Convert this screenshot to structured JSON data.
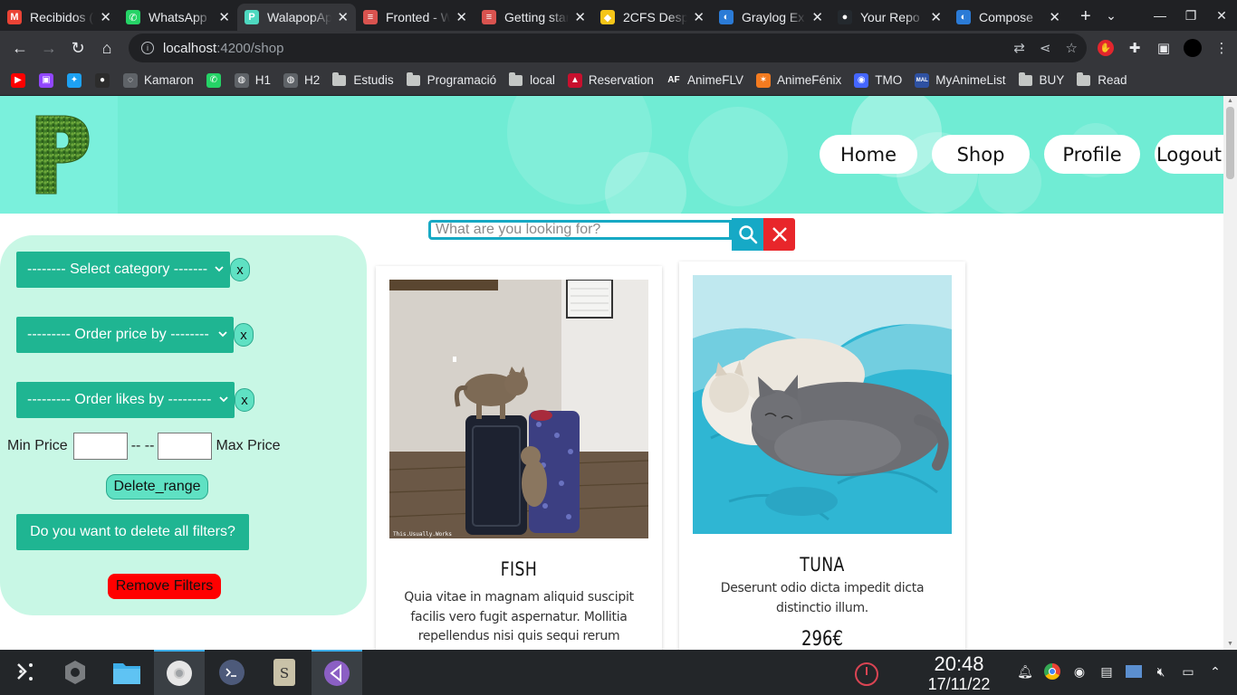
{
  "browser": {
    "tabs": [
      {
        "title": "Recibidos (",
        "icon": "gmail-icon",
        "color": "#ea4335",
        "glyph": "M"
      },
      {
        "title": "WhatsApp",
        "icon": "whatsapp-icon",
        "color": "#25d366",
        "glyph": "✆"
      },
      {
        "title": "WalapopApp",
        "icon": "walapop-icon",
        "color": "#4ed8c0",
        "glyph": "P",
        "active": true
      },
      {
        "title": "Fronted - W",
        "icon": "doc-icon",
        "color": "#d9534f",
        "glyph": "≡"
      },
      {
        "title": "Getting star",
        "icon": "doc-icon",
        "color": "#d9534f",
        "glyph": "≡"
      },
      {
        "title": "2CFS Despl",
        "icon": "drive-icon",
        "color": "#f5c518",
        "glyph": "◆"
      },
      {
        "title": "Graylog Ex",
        "icon": "edge-icon",
        "color": "#2b7bd6",
        "glyph": "◐"
      },
      {
        "title": "Your Repo",
        "icon": "github-icon",
        "color": "#24292e",
        "glyph": "●"
      },
      {
        "title": "Compose",
        "icon": "edge-icon",
        "color": "#2b7bd6",
        "glyph": "◐"
      }
    ],
    "url_host": "localhost",
    "url_path": ":4200/shop",
    "bookmarks": [
      {
        "label": "",
        "type": "youtube",
        "color": "#ff0000",
        "glyph": "▶"
      },
      {
        "label": "",
        "type": "twitch",
        "color": "#9146ff",
        "glyph": "▣"
      },
      {
        "label": "",
        "type": "twitter",
        "color": "#1da1f2",
        "glyph": "✦"
      },
      {
        "label": "",
        "type": "github",
        "color": "#2c2c2c",
        "glyph": "●"
      },
      {
        "label": "Kamaron",
        "type": "globe",
        "color": "#5f6368",
        "glyph": "◌"
      },
      {
        "label": "",
        "type": "whatsapp",
        "color": "#25d366",
        "glyph": "✆"
      },
      {
        "label": "H1",
        "type": "globe",
        "color": "#5f6368",
        "glyph": "◍"
      },
      {
        "label": "H2",
        "type": "globe",
        "color": "#5f6368",
        "glyph": "◍"
      },
      {
        "label": "Estudis",
        "type": "folder"
      },
      {
        "label": "Programació",
        "type": "folder"
      },
      {
        "label": "local",
        "type": "folder"
      },
      {
        "label": "Reservation",
        "type": "site",
        "color": "#c8102e",
        "glyph": "▲"
      },
      {
        "label": "AnimeFLV",
        "type": "site",
        "color": "#35363a",
        "glyph": "AF"
      },
      {
        "label": "AnimeFénix",
        "type": "site",
        "color": "#f47b20",
        "glyph": "✶"
      },
      {
        "label": "TMO",
        "type": "site",
        "color": "#4466ff",
        "glyph": "◉"
      },
      {
        "label": "MyAnimeList",
        "type": "site",
        "color": "#2e51a2",
        "glyph": "MAL"
      },
      {
        "label": "BUY",
        "type": "folder"
      },
      {
        "label": "Read",
        "type": "folder"
      }
    ]
  },
  "header": {
    "nav": [
      {
        "label": "Home",
        "name": "nav-home-button"
      },
      {
        "label": "Shop",
        "name": "nav-shop-button"
      },
      {
        "label": "Profile",
        "name": "nav-profile-button"
      },
      {
        "label": "Logout",
        "name": "nav-logout-button"
      }
    ],
    "accent": "#70ecd4"
  },
  "search": {
    "placeholder": "What are you looking for?"
  },
  "filters": {
    "category_label": "-------- Select category -------",
    "order_price_label": "--------- Order price by --------",
    "order_likes_label": "--------- Order likes by ---------",
    "clear_x": "x",
    "min_price_label": "Min Price",
    "separator": "-- --",
    "max_price_label": "Max Price",
    "delete_range_label": "Delete_range",
    "delete_all_label": "Do you want to delete all filters?",
    "remove_filters_label": "Remove Filters"
  },
  "products": [
    {
      "title": "FISH",
      "description": "Quia vitae in magnam aliquid suscipit facilis vero fugit aspernatur. Mollitia repellendus nisi quis sequi rerum voluptate eum. Facere dicta vitae voluptatem neque",
      "price": "",
      "photo_caption": "This.Usually.Works"
    },
    {
      "title": "TUNA",
      "description": "Deserunt odio dicta impedit dicta distinctio illum.",
      "price": "296€",
      "photo_caption": ""
    }
  ],
  "taskbar": {
    "time": "20:48",
    "date": "17/11/22"
  }
}
